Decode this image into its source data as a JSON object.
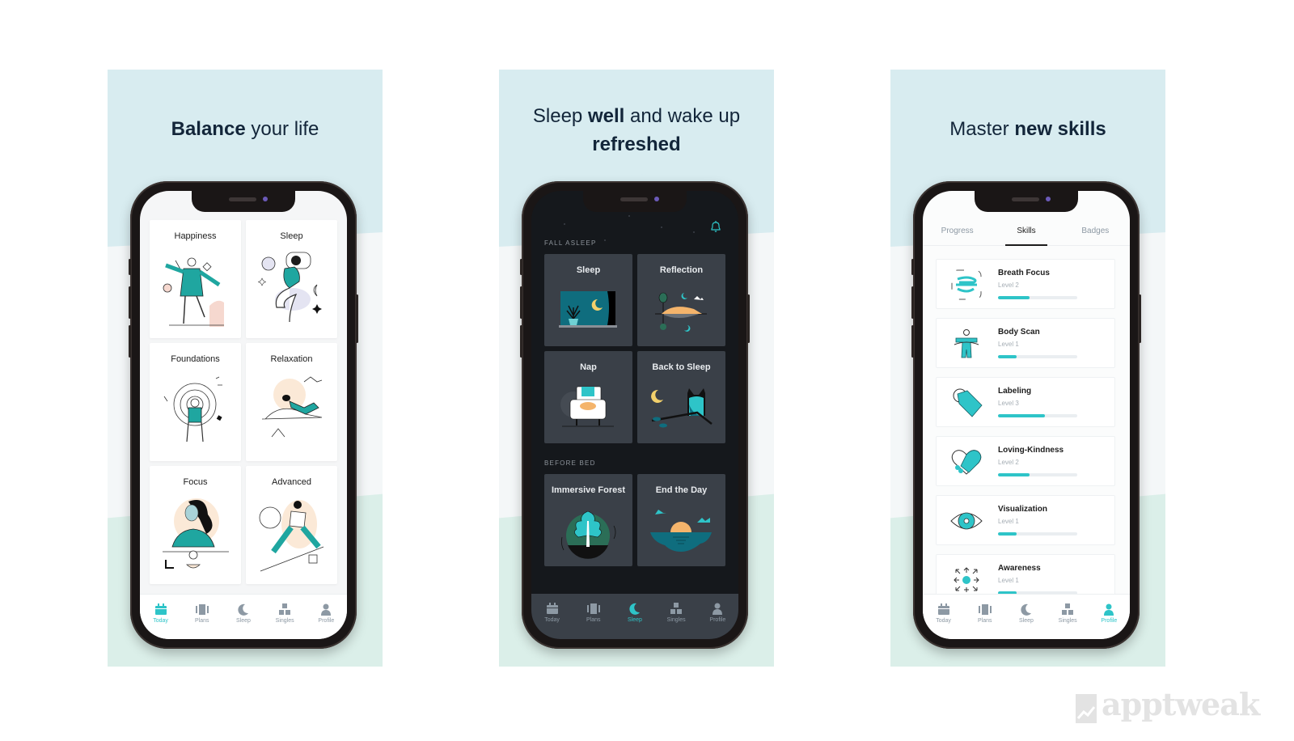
{
  "accent_color": "#2ec4c8",
  "panels": [
    {
      "headline": {
        "plain_1": "",
        "bold_1": "Balance",
        "plain_2": " your life",
        "bold_2": ""
      },
      "screen_theme": "light",
      "cards": [
        {
          "title": "Happiness",
          "icon": "dancing-person-illustration"
        },
        {
          "title": "Sleep",
          "icon": "sleeping-person-illustration"
        },
        {
          "title": "Foundations",
          "icon": "meditating-person-illustration"
        },
        {
          "title": "Relaxation",
          "icon": "reclining-person-illustration"
        },
        {
          "title": "Focus",
          "icon": "focused-woman-illustration"
        },
        {
          "title": "Advanced",
          "icon": "climbing-person-illustration"
        }
      ],
      "tabbar": [
        {
          "label": "Today",
          "icon": "calendar-icon",
          "active": true
        },
        {
          "label": "Plans",
          "icon": "plans-icon",
          "active": false
        },
        {
          "label": "Sleep",
          "icon": "moon-icon",
          "active": false
        },
        {
          "label": "Singles",
          "icon": "blocks-icon",
          "active": false
        },
        {
          "label": "Profile",
          "icon": "person-icon",
          "active": false
        }
      ]
    },
    {
      "headline": {
        "plain_1": "Sleep ",
        "bold_1": "well",
        "plain_2": " and wake up",
        "bold_2": "refreshed"
      },
      "screen_theme": "dark",
      "bell_icon": "bell-icon",
      "sections": [
        {
          "label": "FALL ASLEEP",
          "cards": [
            {
              "title": "Sleep",
              "icon": "night-window-illustration"
            },
            {
              "title": "Reflection",
              "icon": "island-reflection-illustration"
            },
            {
              "title": "Nap",
              "icon": "armchair-cat-illustration"
            },
            {
              "title": "Back to Sleep",
              "icon": "owl-moon-illustration"
            }
          ]
        },
        {
          "label": "BEFORE BED",
          "cards": [
            {
              "title": "Immersive Forest",
              "icon": "forest-leaf-illustration"
            },
            {
              "title": "End the Day",
              "icon": "sunset-sea-illustration"
            }
          ]
        }
      ],
      "tabbar": [
        {
          "label": "Today",
          "icon": "calendar-icon",
          "active": false
        },
        {
          "label": "Plans",
          "icon": "plans-icon",
          "active": false
        },
        {
          "label": "Sleep",
          "icon": "moon-icon",
          "active": true
        },
        {
          "label": "Singles",
          "icon": "blocks-icon",
          "active": false
        },
        {
          "label": "Profile",
          "icon": "person-icon",
          "active": false
        }
      ]
    },
    {
      "headline": {
        "plain_1": "Master ",
        "bold_1": "new skills",
        "plain_2": "",
        "bold_2": ""
      },
      "screen_theme": "light",
      "segments": [
        {
          "label": "Progress",
          "active": false
        },
        {
          "label": "Skills",
          "active": true
        },
        {
          "label": "Badges",
          "active": false
        }
      ],
      "skills": [
        {
          "name": "Breath Focus",
          "level": "Level 2",
          "progress": 0.4,
          "icon": "breath-icon"
        },
        {
          "name": "Body Scan",
          "level": "Level 1",
          "progress": 0.23,
          "icon": "body-scan-icon"
        },
        {
          "name": "Labeling",
          "level": "Level 3",
          "progress": 0.59,
          "icon": "tag-icon"
        },
        {
          "name": "Loving-Kindness",
          "level": "Level 2",
          "progress": 0.4,
          "icon": "heart-handshake-icon"
        },
        {
          "name": "Visualization",
          "level": "Level 1",
          "progress": 0.23,
          "icon": "eye-icon"
        },
        {
          "name": "Awareness",
          "level": "Level 1",
          "progress": 0.23,
          "icon": "awareness-arrows-icon"
        }
      ],
      "tabbar": [
        {
          "label": "Today",
          "icon": "calendar-icon",
          "active": false
        },
        {
          "label": "Plans",
          "icon": "plans-icon",
          "active": false
        },
        {
          "label": "Sleep",
          "icon": "moon-icon",
          "active": false
        },
        {
          "label": "Singles",
          "icon": "blocks-icon",
          "active": false
        },
        {
          "label": "Profile",
          "icon": "person-icon",
          "active": true
        }
      ]
    }
  ],
  "watermark": "apptweak"
}
